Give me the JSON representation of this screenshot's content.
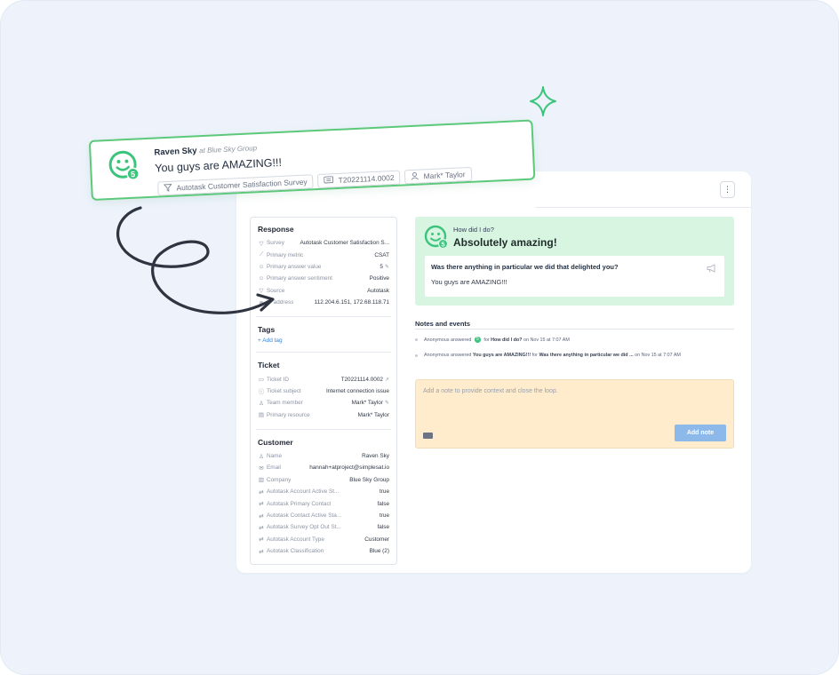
{
  "colors": {
    "accent_green": "#3cc47c",
    "card_border_green": "#5cc97a",
    "note_bg": "#feeccd",
    "button_blue": "#8cb8ea",
    "response_bg": "#d8f5e1"
  },
  "floating_card": {
    "name": "Raven Sky",
    "company": "at Blue Sky Group",
    "comment": "You guys are AMAZING!!!",
    "score": "5",
    "chips": {
      "survey": "Autotask Customer Satisfaction Survey",
      "ticket": "T20221114.0002",
      "member": "Mark* Taylor"
    }
  },
  "menu_button": "⋮",
  "response": {
    "title": "Response",
    "rows": [
      {
        "icon": "filter-icon",
        "label": "Survey",
        "value": "Autotask Customer Satisfaction S..."
      },
      {
        "icon": "chart-icon",
        "label": "Primary metric",
        "value": "CSAT"
      },
      {
        "icon": "smile-icon",
        "label": "Primary answer value",
        "value": "5"
      },
      {
        "icon": "sentiment-icon",
        "label": "Primary answer sentiment",
        "value": "Positive"
      },
      {
        "icon": "filter-icon",
        "label": "Source",
        "value": "Autotask"
      },
      {
        "icon": "globe-icon",
        "label": "IP address",
        "value": "112.204.6.151, 172.68.118.71"
      }
    ]
  },
  "tags": {
    "title": "Tags",
    "add_label": "+ Add tag"
  },
  "ticket": {
    "title": "Ticket",
    "rows": [
      {
        "icon": "ticket-icon",
        "label": "Ticket ID",
        "value": "T20221114.0002"
      },
      {
        "icon": "info-icon",
        "label": "Ticket subject",
        "value": "Internet connection issue"
      },
      {
        "icon": "person-icon",
        "label": "Team member",
        "value": "Mark* Taylor"
      },
      {
        "icon": "resource-icon",
        "label": "Primary resource",
        "value": "Mark* Taylor"
      }
    ]
  },
  "customer": {
    "title": "Customer",
    "rows": [
      {
        "icon": "person-icon",
        "label": "Name",
        "value": "Raven Sky"
      },
      {
        "icon": "mail-icon",
        "label": "Email",
        "value": "hannah+atproject@simplesat.io"
      },
      {
        "icon": "building-icon",
        "label": "Company",
        "value": "Blue Sky Group"
      },
      {
        "icon": "sync-icon",
        "label": "Autotask Account Active St...",
        "value": "true"
      },
      {
        "icon": "sync-icon",
        "label": "Autotask Primary Contact",
        "value": "false"
      },
      {
        "icon": "sync-icon",
        "label": "Autotask Contact Active Sta...",
        "value": "true"
      },
      {
        "icon": "sync-icon",
        "label": "Autotask Survey Opt Out St...",
        "value": "false"
      },
      {
        "icon": "sync-icon",
        "label": "Autotask Account Type",
        "value": "Customer"
      },
      {
        "icon": "sync-icon",
        "label": "Autotask Classification",
        "value": "Blue (2)"
      }
    ]
  },
  "answer": {
    "question": "How did I do?",
    "answer": "Absolutely amazing!",
    "followup_question": "Was there anything in particular we did that delighted you?",
    "followup_answer": "You guys are AMAZING!!!"
  },
  "notes": {
    "title": "Notes and events",
    "events": [
      {
        "who": "Anonymous",
        "verb": "answered",
        "badge": "5",
        "prep": "for",
        "what": "How did I do?",
        "when": "on Nov 15 at 7:07 AM"
      },
      {
        "who": "Anonymous",
        "verb": "answered",
        "answer": "You guys are AMAZING!!!",
        "prep": "for",
        "what": "Was there anything in particular we did ...",
        "when": "on Nov 15 at 7:07 AM"
      }
    ],
    "placeholder": "Add a note to provide context and close the loop.",
    "button": "Add note"
  }
}
